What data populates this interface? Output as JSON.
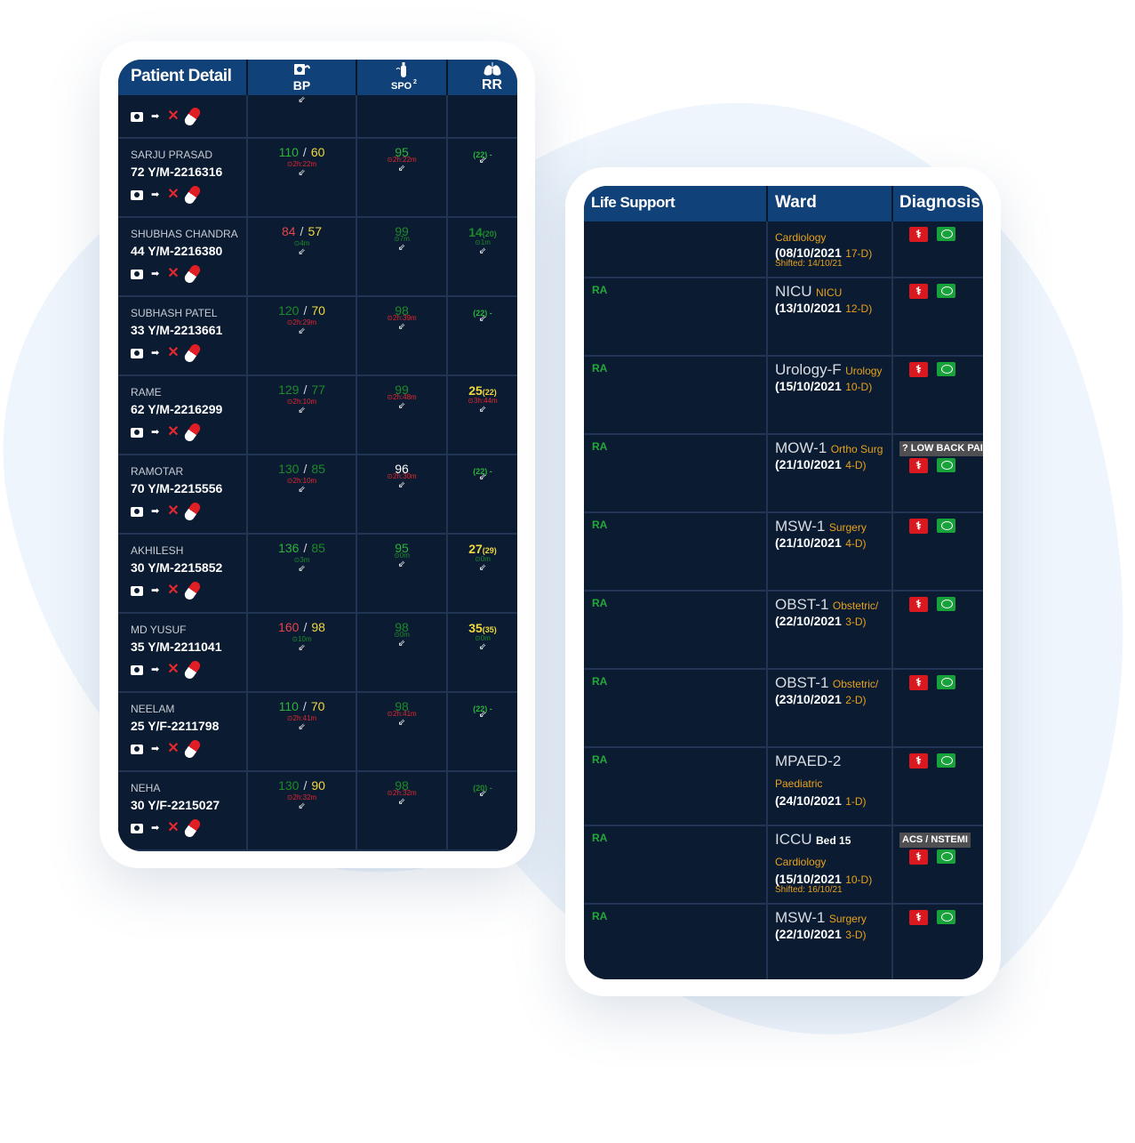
{
  "patients_panel": {
    "headers": {
      "patient": "Patient Detail",
      "bp": "BP",
      "spo": "SPO",
      "spo_sub": "2",
      "rr": "RR"
    },
    "rows": [
      {
        "name": "SARJU PRASAD",
        "age": "72 Y/M-2216316",
        "bp_sys": "110",
        "bp_sep": "/",
        "bp_dia": "60",
        "bp_time": "2h:22m",
        "bp_sys_color": "g",
        "bp_dia_color": "y",
        "spo": "95",
        "spo_time": "2h:22m",
        "spo_color": "g",
        "spo_time_color": "rr",
        "rr": "",
        "rr_sub": "(22) -",
        "rr_color": "g",
        "rr_time": ""
      },
      {
        "name": "SHUBHAS CHANDRA",
        "age": "44 Y/M-2216380",
        "bp_sys": "84",
        "bp_sep": "/",
        "bp_dia": "57",
        "bp_time": "4m",
        "bp_sys_color": "r",
        "bp_dia_color": "y",
        "spo": "99",
        "spo_time": "7m",
        "spo_color": "dg",
        "spo_time_color": "dg",
        "rr": "14",
        "rr_sub": "(20)",
        "rr_color": "dg",
        "rr_time": "1m"
      },
      {
        "name": "SUBHASH PATEL",
        "age": "33 Y/M-2213661",
        "bp_sys": "120",
        "bp_sep": "/",
        "bp_dia": "70",
        "bp_time": "2h:29m",
        "bp_sys_color": "dg",
        "bp_dia_color": "y",
        "spo": "98",
        "spo_time": "2h:39m",
        "spo_color": "dg",
        "spo_time_color": "rr",
        "rr": "",
        "rr_sub": "(22) -",
        "rr_color": "g",
        "rr_time": ""
      },
      {
        "name": "RAME",
        "age": "62 Y/M-2216299",
        "bp_sys": "129",
        "bp_sep": "/",
        "bp_dia": "77",
        "bp_time": "2h:10m",
        "bp_sys_color": "dg",
        "bp_dia_color": "dg",
        "spo": "99",
        "spo_time": "2h:48m",
        "spo_color": "dg",
        "spo_time_color": "rr",
        "rr": "25",
        "rr_sub": "(22)",
        "rr_color": "y",
        "rr_time": "3h:44m"
      },
      {
        "name": "RAMOTAR",
        "age": "70 Y/M-2215556",
        "bp_sys": "130",
        "bp_sep": "/",
        "bp_dia": "85",
        "bp_time": "2h:10m",
        "bp_sys_color": "dg",
        "bp_dia_color": "dg",
        "spo": "96",
        "spo_time": "2h:30m",
        "spo_color": "w",
        "spo_time_color": "rr",
        "rr": "",
        "rr_sub": "(22) -",
        "rr_color": "g",
        "rr_time": ""
      },
      {
        "name": "AKHILESH",
        "age": "30 Y/M-2215852",
        "bp_sys": "136",
        "bp_sep": "/",
        "bp_dia": "85",
        "bp_time": "3m",
        "bp_sys_color": "g",
        "bp_dia_color": "dg",
        "spo": "95",
        "spo_time": "0m",
        "spo_color": "g",
        "spo_time_color": "dg",
        "rr": "27",
        "rr_sub": "(29)",
        "rr_color": "y",
        "rr_time": "0m"
      },
      {
        "name": "MD YUSUF",
        "age": "35 Y/M-2211041",
        "bp_sys": "160",
        "bp_sep": "/",
        "bp_dia": "98",
        "bp_time": "10m",
        "bp_sys_color": "r",
        "bp_dia_color": "y",
        "spo": "98",
        "spo_time": "0m",
        "spo_color": "dg",
        "spo_time_color": "dg",
        "rr": "35",
        "rr_sub": "(35)",
        "rr_color": "y",
        "rr_time": "0m"
      },
      {
        "name": "NEELAM",
        "age": "25 Y/F-2211798",
        "bp_sys": "110",
        "bp_sep": "/",
        "bp_dia": "70",
        "bp_time": "2h:41m",
        "bp_sys_color": "g",
        "bp_dia_color": "y",
        "spo": "98",
        "spo_time": "2h:41m",
        "spo_color": "dg",
        "spo_time_color": "rr",
        "rr": "",
        "rr_sub": "(22) -",
        "rr_color": "g",
        "rr_time": ""
      },
      {
        "name": "NEHA",
        "age": "30 Y/F-2215027",
        "bp_sys": "130",
        "bp_sep": "/",
        "bp_dia": "90",
        "bp_time": "2h:32m",
        "bp_sys_color": "dg",
        "bp_dia_color": "y",
        "spo": "98",
        "spo_time": "2h:32m",
        "spo_color": "dg",
        "spo_time_color": "rr",
        "rr": "",
        "rr_sub": "(20) -",
        "rr_color": "dg",
        "rr_time": ""
      }
    ]
  },
  "ward_panel": {
    "headers": {
      "life_support": "Life Support",
      "ward": "Ward",
      "diagnosis": "Diagnosis"
    },
    "rows": [
      {
        "ls": "",
        "ward": "",
        "dept_top": "Cardiology",
        "dept": "",
        "date": "(08/10/2021",
        "days": "17-D)",
        "shifted": "Shifted: 14/10/21",
        "diag": ""
      },
      {
        "ls": "RA",
        "ward": "NICU",
        "dept_top": "",
        "dept": "NICU",
        "date": "(13/10/2021",
        "days": "12-D)",
        "shifted": "",
        "diag": ""
      },
      {
        "ls": "RA",
        "ward": "Urology-F",
        "dept_top": "",
        "dept": "Urology",
        "date": "(15/10/2021",
        "days": "10-D)",
        "shifted": "",
        "diag": ""
      },
      {
        "ls": "RA",
        "ward": "MOW-1",
        "dept_top": "",
        "dept": "Ortho Surg",
        "date": "(21/10/2021",
        "days": "4-D)",
        "shifted": "",
        "diag": "? LOW BACK PAIN"
      },
      {
        "ls": "RA",
        "ward": "MSW-1",
        "dept_top": "",
        "dept": "Surgery",
        "date": "(21/10/2021",
        "days": "4-D)",
        "shifted": "",
        "diag": ""
      },
      {
        "ls": "RA",
        "ward": "OBST-1",
        "dept_top": "",
        "dept": "Obstetric/",
        "date": "(22/10/2021",
        "days": "3-D)",
        "shifted": "",
        "diag": ""
      },
      {
        "ls": "RA",
        "ward": "OBST-1",
        "dept_top": "",
        "dept": "Obstetric/",
        "date": "(23/10/2021",
        "days": "2-D)",
        "shifted": "",
        "diag": ""
      },
      {
        "ls": "RA",
        "ward": "MPAED-2",
        "dept_top": "",
        "dept": "",
        "dept_below": "Paediatric",
        "date": "(24/10/2021",
        "days": "1-D)",
        "shifted": "",
        "diag": ""
      },
      {
        "ls": "RA",
        "ward": "ICCU",
        "bed": "Bed 15",
        "dept_top": "",
        "dept": "",
        "dept_below": "Cardiology",
        "date": "(15/10/2021",
        "days": "10-D)",
        "shifted": "Shifted: 16/10/21",
        "diag": "ACS / NSTEMI"
      },
      {
        "ls": "RA",
        "ward": "MSW-1",
        "dept_top": "",
        "dept": "Surgery",
        "date": "(22/10/2021",
        "days": "3-D)",
        "shifted": "",
        "diag": ""
      }
    ]
  },
  "icons": [
    "camera-icon",
    "exit-icon",
    "bell-off-icon",
    "pill-icon",
    "bp-monitor-icon",
    "oxygen-icon",
    "lungs-icon",
    "trend-arrow-icon",
    "bed-icon",
    "chat-icon"
  ],
  "colors": {
    "header_bg": "#104178",
    "row_bg": "#0a1b32",
    "alert_red": "#e4282e",
    "normal_green": "#2bb33a",
    "warn_yellow": "#f1d93e",
    "dept_orange": "#e9a21a"
  }
}
